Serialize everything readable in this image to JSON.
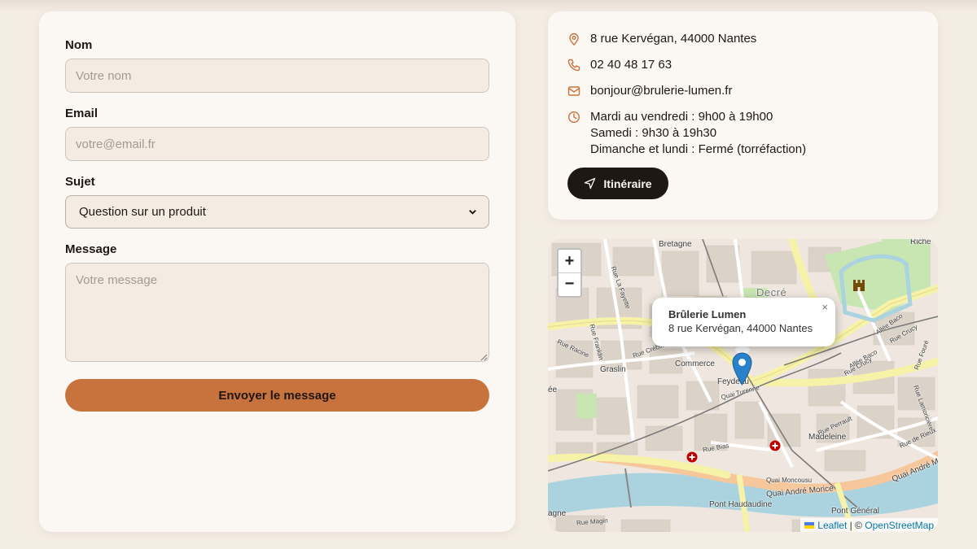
{
  "form": {
    "name_label": "Nom",
    "name_placeholder": "Votre nom",
    "email_label": "Email",
    "email_placeholder": "votre@email.fr",
    "subject_label": "Sujet",
    "subject_value": "Question sur un produit",
    "message_label": "Message",
    "message_placeholder": "Votre message",
    "submit_label": "Envoyer le message"
  },
  "contact": {
    "address": "8 rue Kervégan, 44000 Nantes",
    "phone": "02 40 48 17 63",
    "email": "bonjour@brulerie-lumen.fr",
    "hours": [
      "Mardi au vendredi : 9h00 à 19h00",
      "Samedi : 9h30 à 19h30",
      "Dimanche et lundi : Fermé (torréfaction)"
    ],
    "route_label": "Itinéraire",
    "icons": [
      "map-pin-icon",
      "phone-icon",
      "mail-icon",
      "clock-icon",
      "navigation-icon"
    ],
    "accent_color": "#c8723d"
  },
  "map": {
    "zoom_in": "+",
    "zoom_out": "−",
    "popup_title": "Brûlerie Lumen",
    "popup_address": "8 rue Kervégan, 44000 Nantes",
    "popup_close": "×",
    "attribution_leaflet": "Leaflet",
    "attribution_sep": " | © ",
    "attribution_osm": "OpenStreetMap",
    "labels": {
      "bretagne": "Bretagne",
      "decre": "Decré",
      "richebourg": "Riche",
      "rue_la_fayette": "Rue La Fayette",
      "rue_franklin": "Rue Franklin",
      "rue_racine": "Rue Racine",
      "rue_crebillon": "Rue Crébillon",
      "graslin": "Graslin",
      "commerce": "Commerce",
      "feydeau": "Feydeau",
      "quai_turenne": "Quai Turenne",
      "allee_baco": "Allée Baco",
      "rue_crucy": "Rue Crucy",
      "rue_perrault": "Rue Perrault",
      "madeleine": "Madeleine",
      "rue_bias": "Rue Bias",
      "quai_moncousu": "Quai Moncousu",
      "quai_andre_morice": "Quai André Morice",
      "pont_haudaudine": "Pont Haudaudine",
      "pont_general": "Pont Général",
      "rue_magin": "Rue Magin",
      "rue_de_rieux": "Rue de Rieux",
      "rue_lamoriciere": "Rue Lamoricière",
      "rue_fouré": "Rue Fouré",
      "agne": "agne",
      "ee": "ée"
    }
  }
}
